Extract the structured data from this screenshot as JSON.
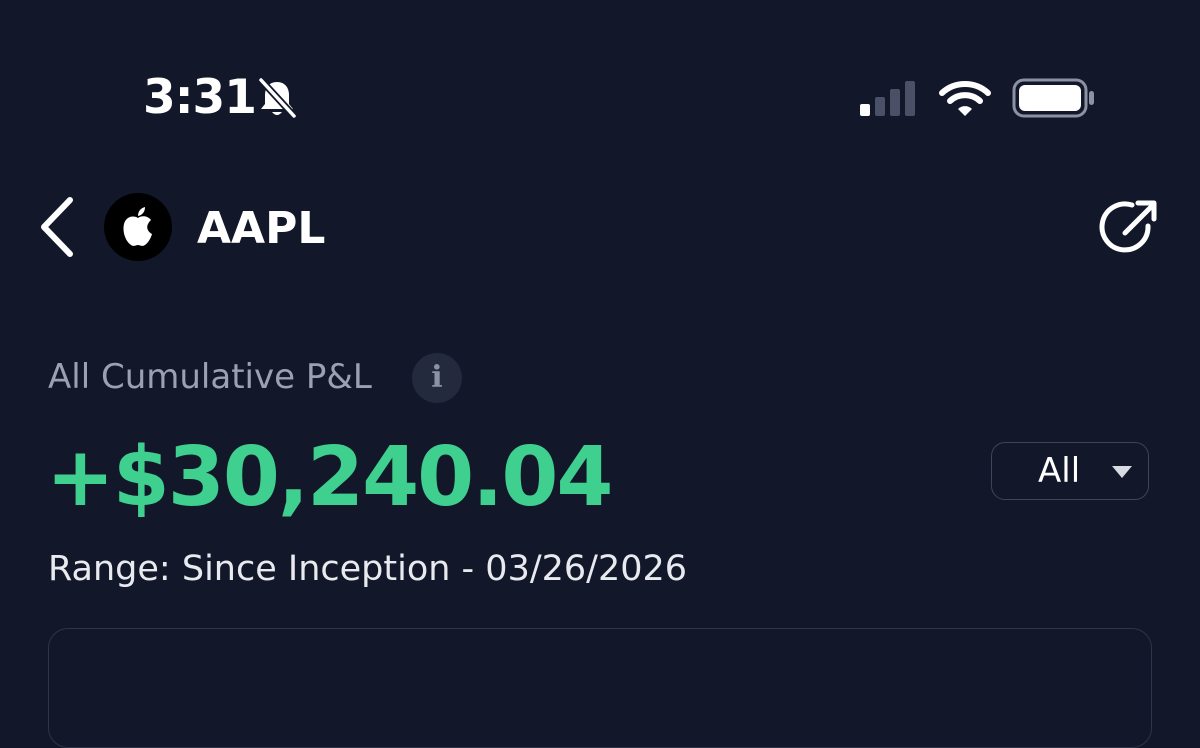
{
  "status_bar": {
    "time": "3:31",
    "icons": [
      "bell-slash-icon",
      "cellular-signal-icon",
      "wifi-icon",
      "battery-icon"
    ]
  },
  "header": {
    "ticker": "AAPL",
    "logo": "apple-logo-icon",
    "back_icon": "chevron-left-icon",
    "share_icon": "share-arrow-icon"
  },
  "pnl": {
    "label": "All Cumulative P&L",
    "info_icon": "info-icon",
    "info_glyph": "i",
    "value": "+$30,240.04",
    "value_color": "#3fcf8e"
  },
  "range_select": {
    "selected": "All",
    "icon": "caret-down-icon"
  },
  "range_text": "Range: Since Inception - 03/26/2026",
  "colors": {
    "background": "#121829",
    "accent_positive": "#3fcf8e",
    "muted_text": "#9aa1b2"
  }
}
